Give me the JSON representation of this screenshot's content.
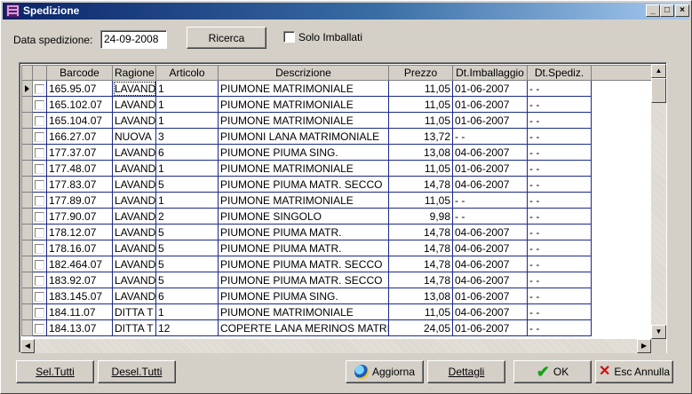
{
  "window": {
    "title": "Spedizione",
    "minimize": "_",
    "maximize": "□",
    "close": "×"
  },
  "filter": {
    "date_label": "Data spedizione:",
    "date_value": "24-09-2008",
    "search_button": "Ricerca",
    "only_packed_label": "Solo Imballati",
    "only_packed_checked": false
  },
  "grid": {
    "columns": [
      "Barcode",
      "Ragione",
      "Articolo",
      "Descrizione",
      "Prezzo",
      "Dt.Imballaggio",
      "Dt.Spediz."
    ],
    "rows": [
      {
        "barcode": "165.95.07",
        "ragione": "LAVAND",
        "articolo": "1",
        "descrizione": "PIUMONE MATRIMONIALE",
        "prezzo": "11,05",
        "dt_imballaggio": "01-06-2007",
        "dt_spediz": "- -"
      },
      {
        "barcode": "165.102.07",
        "ragione": "LAVAND",
        "articolo": "1",
        "descrizione": "PIUMONE MATRIMONIALE",
        "prezzo": "11,05",
        "dt_imballaggio": "01-06-2007",
        "dt_spediz": "- -"
      },
      {
        "barcode": "165.104.07",
        "ragione": "LAVAND",
        "articolo": "1",
        "descrizione": "PIUMONE MATRIMONIALE",
        "prezzo": "11,05",
        "dt_imballaggio": "01-06-2007",
        "dt_spediz": "- -"
      },
      {
        "barcode": "166.27.07",
        "ragione": "NUOVA",
        "articolo": "3",
        "descrizione": "PIUMONI LANA  MATRIMONIALE",
        "prezzo": "13,72",
        "dt_imballaggio": "- -",
        "dt_spediz": "- -"
      },
      {
        "barcode": "177.37.07",
        "ragione": "LAVAND",
        "articolo": "6",
        "descrizione": "PIUMONE PIUMA SING.",
        "prezzo": "13,08",
        "dt_imballaggio": "04-06-2007",
        "dt_spediz": "- -"
      },
      {
        "barcode": "177.48.07",
        "ragione": "LAVAND",
        "articolo": "1",
        "descrizione": "PIUMONE MATRIMONIALE",
        "prezzo": "11,05",
        "dt_imballaggio": "01-06-2007",
        "dt_spediz": "- -"
      },
      {
        "barcode": "177.83.07",
        "ragione": "LAVAND",
        "articolo": "5",
        "descrizione": "PIUMONE PIUMA MATR.  SECCO",
        "prezzo": "14,78",
        "dt_imballaggio": "04-06-2007",
        "dt_spediz": "- -"
      },
      {
        "barcode": "177.89.07",
        "ragione": "LAVAND",
        "articolo": "1",
        "descrizione": "PIUMONE MATRIMONIALE",
        "prezzo": "11,05",
        "dt_imballaggio": "- -",
        "dt_spediz": "- -"
      },
      {
        "barcode": "177.90.07",
        "ragione": "LAVAND",
        "articolo": "2",
        "descrizione": "PIUMONE SINGOLO",
        "prezzo": "9,98",
        "dt_imballaggio": "- -",
        "dt_spediz": "- -"
      },
      {
        "barcode": "178.12.07",
        "ragione": "LAVAND",
        "articolo": "5",
        "descrizione": "PIUMONE PIUMA MATR.",
        "prezzo": "14,78",
        "dt_imballaggio": "04-06-2007",
        "dt_spediz": "- -"
      },
      {
        "barcode": "178.16.07",
        "ragione": "LAVAND",
        "articolo": "5",
        "descrizione": "PIUMONE PIUMA MATR.",
        "prezzo": "14,78",
        "dt_imballaggio": "04-06-2007",
        "dt_spediz": "- -"
      },
      {
        "barcode": "182.464.07",
        "ragione": "LAVAND",
        "articolo": "5",
        "descrizione": "PIUMONE PIUMA MATR.  SECCO",
        "prezzo": "14,78",
        "dt_imballaggio": "04-06-2007",
        "dt_spediz": "- -"
      },
      {
        "barcode": "183.92.07",
        "ragione": "LAVAND",
        "articolo": "5",
        "descrizione": "PIUMONE PIUMA MATR.  SECCO",
        "prezzo": "14,78",
        "dt_imballaggio": "04-06-2007",
        "dt_spediz": "- -"
      },
      {
        "barcode": "183.145.07",
        "ragione": "LAVAND",
        "articolo": "6",
        "descrizione": "PIUMONE PIUMA SING.",
        "prezzo": "13,08",
        "dt_imballaggio": "01-06-2007",
        "dt_spediz": "- -"
      },
      {
        "barcode": "184.11.07",
        "ragione": "DITTA T",
        "articolo": "1",
        "descrizione": "PIUMONE MATRIMONIALE",
        "prezzo": "11,05",
        "dt_imballaggio": "04-06-2007",
        "dt_spediz": "- -"
      },
      {
        "barcode": "184.13.07",
        "ragione": "DITTA T",
        "articolo": "12",
        "descrizione": "COPERTE LANA MERINOS MATRI",
        "prezzo": "24,05",
        "dt_imballaggio": "01-06-2007",
        "dt_spediz": "- -"
      }
    ]
  },
  "buttons": {
    "select_all": "Sel.Tutti",
    "deselect_all": "Desel.Tutti",
    "refresh": "Aggiorna",
    "details": "Dettagli",
    "ok": "OK",
    "cancel": "Esc Annulla"
  },
  "icons": {
    "window": "list-icon",
    "refresh": "refresh-icon",
    "ok": "check-icon",
    "cancel": "x-icon",
    "row_indicator": "current-row-arrow-icon"
  },
  "colors": {
    "titlebar_start": "#0a246a",
    "titlebar_end": "#a6caf0",
    "grid_lines": "#1c2a8c",
    "face": "#d4d0c8",
    "ok_green": "#18a018",
    "cancel_red": "#d01010"
  }
}
